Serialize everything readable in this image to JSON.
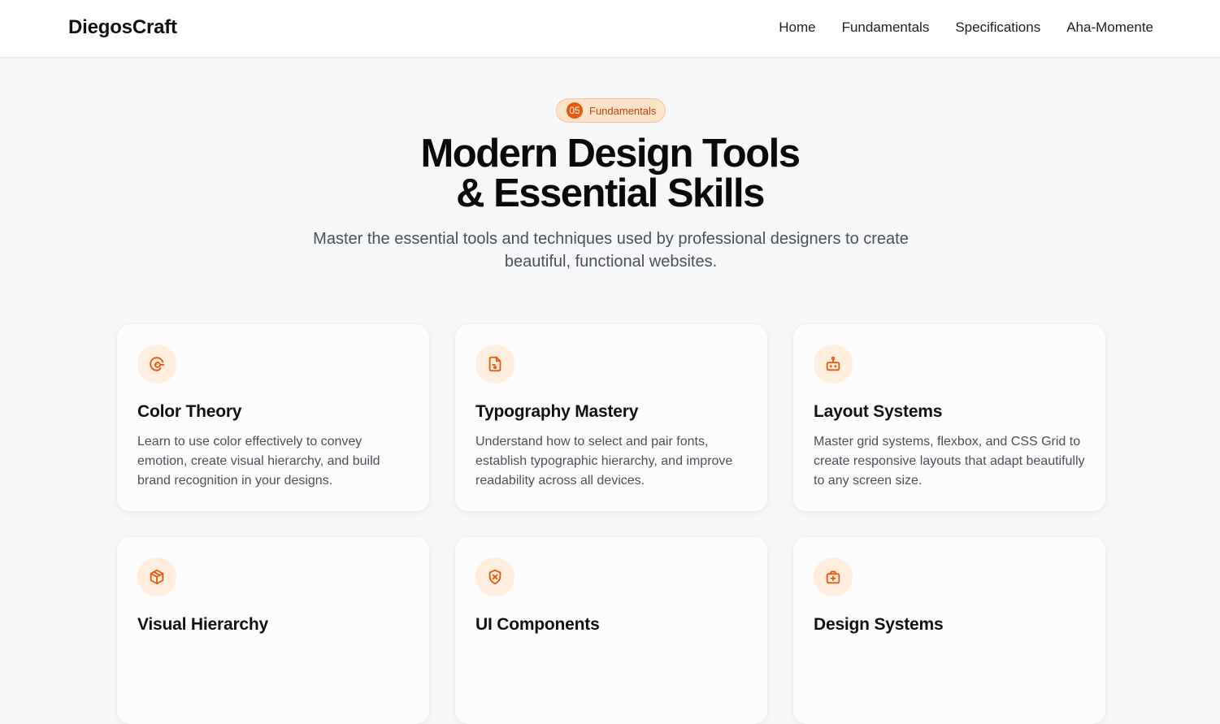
{
  "header": {
    "brand": "DiegosCraft",
    "nav": [
      "Home",
      "Fundamentals",
      "Specifications",
      "Aha-Momente"
    ]
  },
  "hero": {
    "badge_number": "05",
    "badge_label": "Fundamentals",
    "title_line1": "Modern Design Tools",
    "title_line2": "& Essential Skills",
    "subtitle": "Master the essential tools and techniques used by professional designers to create beautiful, functional websites."
  },
  "cards": [
    {
      "icon": "palette-icon",
      "title": "Color Theory",
      "description": "Learn to use color effectively to convey emotion, create visual hierarchy, and build brand recognition in your designs."
    },
    {
      "icon": "typography-file-icon",
      "title": "Typography Mastery",
      "description": "Understand how to select and pair fonts, establish typographic hierarchy, and improve readability across all devices."
    },
    {
      "icon": "layout-robot-icon",
      "title": "Layout Systems",
      "description": "Master grid systems, flexbox, and CSS Grid to create responsive layouts that adapt beautifully to any screen size."
    },
    {
      "icon": "cube-icon",
      "title": "Visual Hierarchy",
      "description": ""
    },
    {
      "icon": "shield-x-icon",
      "title": "UI Components",
      "description": ""
    },
    {
      "icon": "kit-plus-icon",
      "title": "Design Systems",
      "description": ""
    }
  ],
  "colors": {
    "accent": "#ea580c",
    "badge_bg": "#fde3c7",
    "icon_bg": "#ffeedd",
    "page_bg": "#f6f7f9"
  }
}
